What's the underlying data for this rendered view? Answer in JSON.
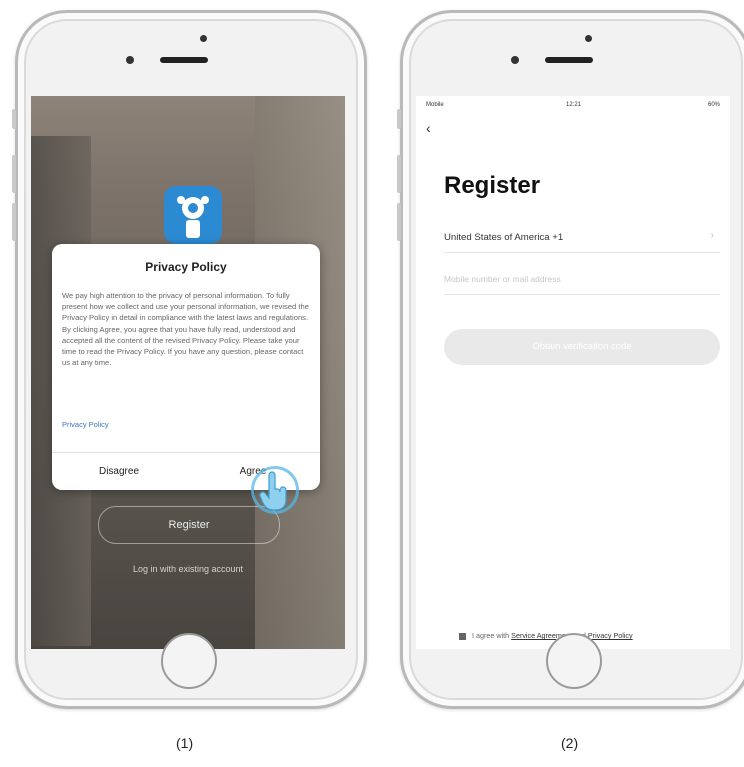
{
  "screens": [
    {
      "caption": "(1)",
      "privacy_dialog": {
        "title": "Privacy Policy",
        "body": "We pay high attention to the privacy of personal information. To fully present how we collect and use your personal information, we revised the Privacy Policy in detail in compliance with the latest laws and regulations. By clicking Agree, you agree that you have fully read, understood and accepted all the content of the revised Privacy Policy. Please take your time to read the Privacy Policy. If you have any question, please contact us at any time.",
        "link": "Privacy Policy",
        "disagree_label": "Disagree",
        "agree_label": "Agree"
      },
      "register_label": "Register",
      "login_label": "Log in with existing account"
    },
    {
      "caption": "(2)",
      "status_bar": {
        "left": "Mobile",
        "time": "12:21",
        "right": "60%"
      },
      "back_icon": "chevron-left-icon",
      "title": "Register",
      "country_field": "United States of America +1",
      "input_placeholder": "Mobile number or mail address",
      "obtain_button": "Obtain verification code",
      "agreement": {
        "prefix": "I agree with",
        "service_link": "Service Agreement",
        "and": "and",
        "privacy_link": "Privacy Policy"
      }
    }
  ],
  "colors": {
    "accent_blue": "#2b8ad2",
    "tap_ring": "#59b7e5",
    "link": "#3b74c4"
  }
}
